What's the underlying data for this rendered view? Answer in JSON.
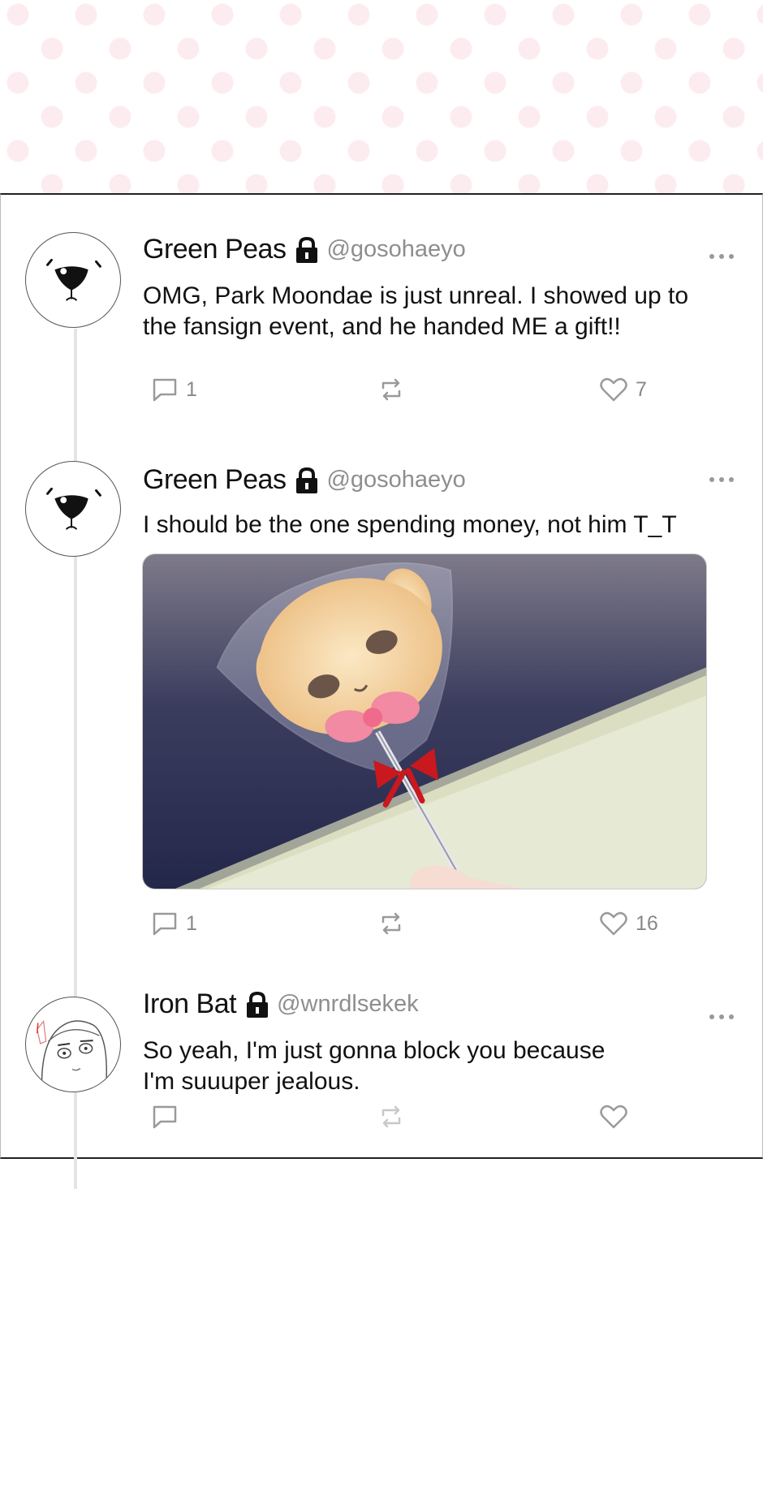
{
  "tweets": [
    {
      "name": "Green Peas",
      "handle": "@gosohaeyo",
      "text_lines": [
        "OMG, Park Moondae is just unreal. I showed up to",
        "the fansign event, and he handed ME a gift!!"
      ],
      "replies": "1",
      "retweets": "",
      "likes": "7"
    },
    {
      "name": "Green Peas",
      "handle": "@gosohaeyo",
      "text_lines": [
        "I should be the one spending money, not him T_T"
      ],
      "replies": "1",
      "retweets": "",
      "likes": "16"
    },
    {
      "name": "Iron Bat",
      "handle": "@wnrdlsekek",
      "text_lines": [
        "So yeah, I'm just gonna block you because",
        "I'm suuuper jealous."
      ],
      "replies": "",
      "retweets": "",
      "likes": ""
    }
  ],
  "icons": {
    "lock": "lock-icon",
    "more": "more-options-icon",
    "reply": "reply-icon",
    "retweet": "retweet-icon",
    "like": "heart-icon"
  },
  "colors": {
    "text": "#111111",
    "handle": "#8e8e8e",
    "icon": "#9a9a9a",
    "border": "#222222",
    "thread_line": "#e4e4e4",
    "banner_dot": "#fdecef"
  }
}
